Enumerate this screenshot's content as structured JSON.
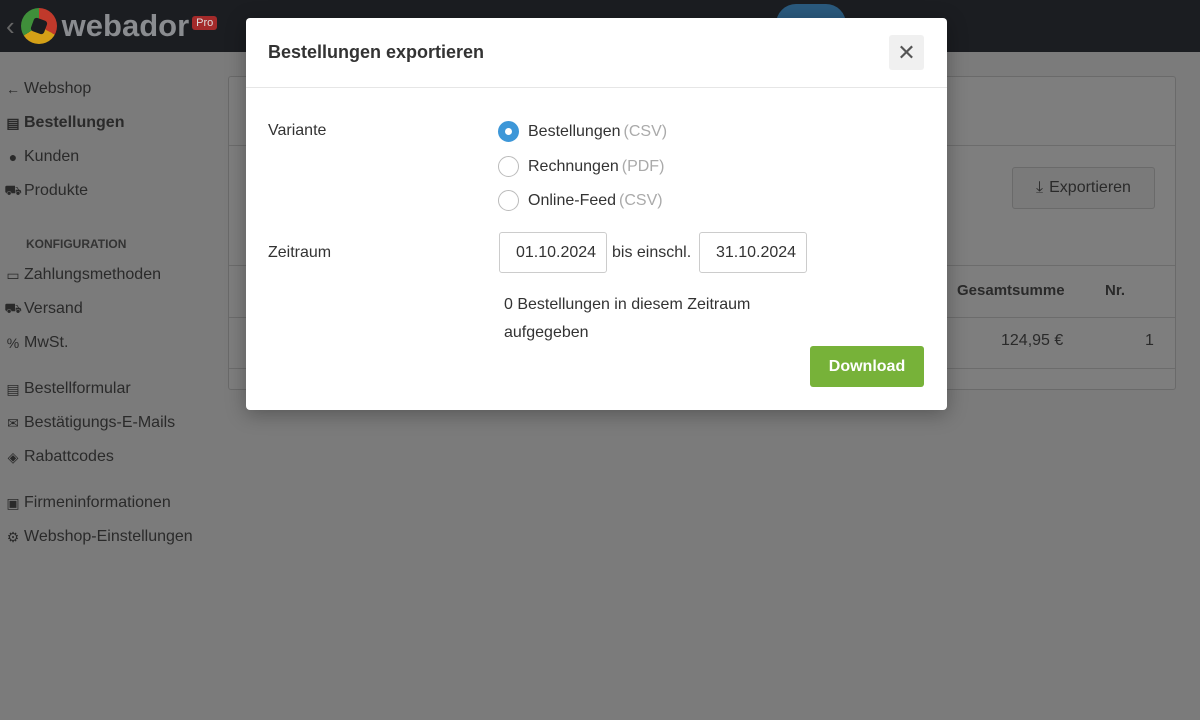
{
  "brand": {
    "name": "webador",
    "badge": "Pro"
  },
  "sidebar": {
    "back": "Webshop",
    "items": [
      {
        "label": "Bestellungen",
        "icon": "document-icon"
      },
      {
        "label": "Kunden",
        "icon": "user-icon"
      },
      {
        "label": "Produkte",
        "icon": "cart-icon"
      }
    ],
    "config_heading": "KONFIGURATION",
    "config": [
      {
        "label": "Zahlungsmethoden"
      },
      {
        "label": "Versand"
      },
      {
        "label": "MwSt."
      }
    ],
    "group2": [
      {
        "label": "Bestellformular"
      },
      {
        "label": "Bestätigungs-E-Mails"
      },
      {
        "label": "Rabattcodes"
      }
    ],
    "group3": [
      {
        "label": "Firmeninformationen"
      },
      {
        "label": "Webshop-Einstellungen"
      }
    ]
  },
  "main": {
    "export_label": "Exportieren",
    "table": {
      "headers": [
        "Gesamtsumme",
        "Nr."
      ],
      "rows": [
        [
          "124,95 €",
          "1"
        ]
      ]
    }
  },
  "modal": {
    "title": "Bestellungen exportieren",
    "variant_label": "Variante",
    "options": [
      {
        "label": "Bestellungen",
        "format": "(CSV)",
        "selected": true
      },
      {
        "label": "Rechnungen",
        "format": "(PDF)",
        "selected": false
      },
      {
        "label": "Online-Feed",
        "format": "(CSV)",
        "selected": false
      }
    ],
    "period_label": "Zeitraum",
    "from": "01.10.2024",
    "to_label": "bis einschl.",
    "to": "31.10.2024",
    "info": "0 Bestellungen in diesem Zeitraum aufgegeben",
    "download": "Download",
    "accent": "#3d97d8",
    "button_color": "#77b239"
  }
}
